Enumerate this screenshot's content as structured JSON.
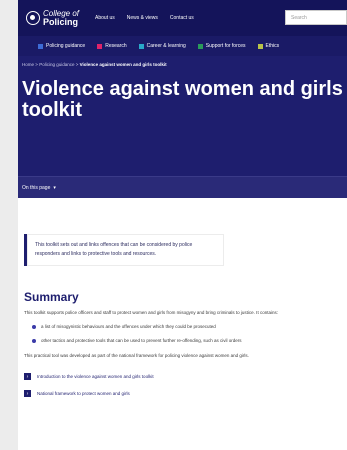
{
  "header": {
    "logo_line1": "College of",
    "logo_line2": "Policing",
    "nav": [
      "About us",
      "News & views",
      "Contact us"
    ],
    "search_placeholder": "Search"
  },
  "subnav": [
    {
      "label": "Policing guidance",
      "color": "#3d6bd6"
    },
    {
      "label": "Research",
      "color": "#e0236a"
    },
    {
      "label": "Career & learning",
      "color": "#29a8c9"
    },
    {
      "label": "Support for forces",
      "color": "#2a9a5a"
    },
    {
      "label": "Ethics",
      "color": "#b8c34a"
    }
  ],
  "breadcrumb": {
    "home": "Home",
    "sep1": ">",
    "parent": "Policing guidance",
    "sep2": ">",
    "current": "Violence against women and girls toolkit"
  },
  "page_title": "Violence against women and girls toolkit",
  "on_page": "On this page",
  "callout": "This toolkit sets out and links offences that can be considered by police responders and links to protective tools and resources.",
  "summary": {
    "heading": "Summary",
    "intro": "This toolkit supports police officers and staff to protect women and girls from misogyny and bring criminals to justice. It contains:",
    "bullets": [
      "a list of misogynistic behaviours and the offences under which they could be prosecuted",
      "other tactics and protective tools that can be used to prevent further re-offending, such as civil orders"
    ],
    "note": "This practical tool was developed as part of the national framework for policing violence against women and girls.",
    "links": [
      "Introduction to the violence against women and girls toolkit",
      "National framework to protect women and girls"
    ]
  }
}
